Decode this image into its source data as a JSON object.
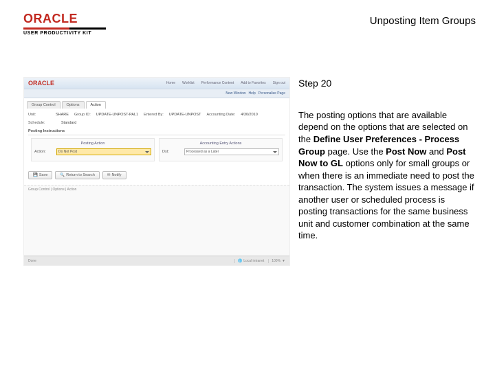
{
  "header": {
    "brand": "ORACLE",
    "sub": "USER PRODUCTIVITY KIT",
    "doc_title": "Unposting Item Groups"
  },
  "instruction": {
    "step": "Step 20",
    "p1_a": "The posting options that are available depend on the options that are selected on the ",
    "p1_b1": "Define User Preferences - Process Group",
    "p1_c": " page. Use the ",
    "p1_b2": "Post Now",
    "p1_d": " and ",
    "p1_b3": "Post Now to GL",
    "p1_e": " options only for small groups or when there is an immediate need to post the transaction. The system issues a message if another user or scheduled process is posting transactions for the same business unit and customer combination at the same time."
  },
  "screenshot": {
    "oracle": "ORACLE",
    "nav": {
      "home": "Home",
      "worklist": "Worklist",
      "performance": "Performance Content",
      "addto": "Add to Favorites",
      "signout": "Sign out"
    },
    "crumb": {
      "newwin": "New Window",
      "help": "Help",
      "personalize": "Personalize Page"
    },
    "tabs": {
      "gc": "Group Control",
      "options": "Options",
      "action": "Action"
    },
    "row1": {
      "unit_l": "Unit:",
      "unit_v": "SHARE",
      "gid_l": "Group ID:",
      "gid_v": "UPDATE-UNPOST-PAL1",
      "enteredby_l": "Entered By:",
      "enteredby_v": "UPDATE-UNPOST",
      "acctdate_l": "Accounting Date:",
      "acctdate_v": "4/30/2010"
    },
    "title": "Posting Instructions",
    "col1": {
      "head": "Posting Action",
      "action_l": "Action:",
      "action_v": "Do Not Post"
    },
    "col2": {
      "head": "Accounting Entry Actions",
      "dst_l": "Dst:",
      "dst_v": "Processed as a Later"
    },
    "schedule": {
      "label": "Schedule:",
      "value": "Standard"
    },
    "buttons": {
      "save": "Save",
      "ret": "Return to Search",
      "notify": "Notify"
    },
    "footer": "Group Control | Options | Action",
    "status": {
      "done": "Done",
      "local": "Local intranet",
      "zoom": "100%"
    }
  }
}
